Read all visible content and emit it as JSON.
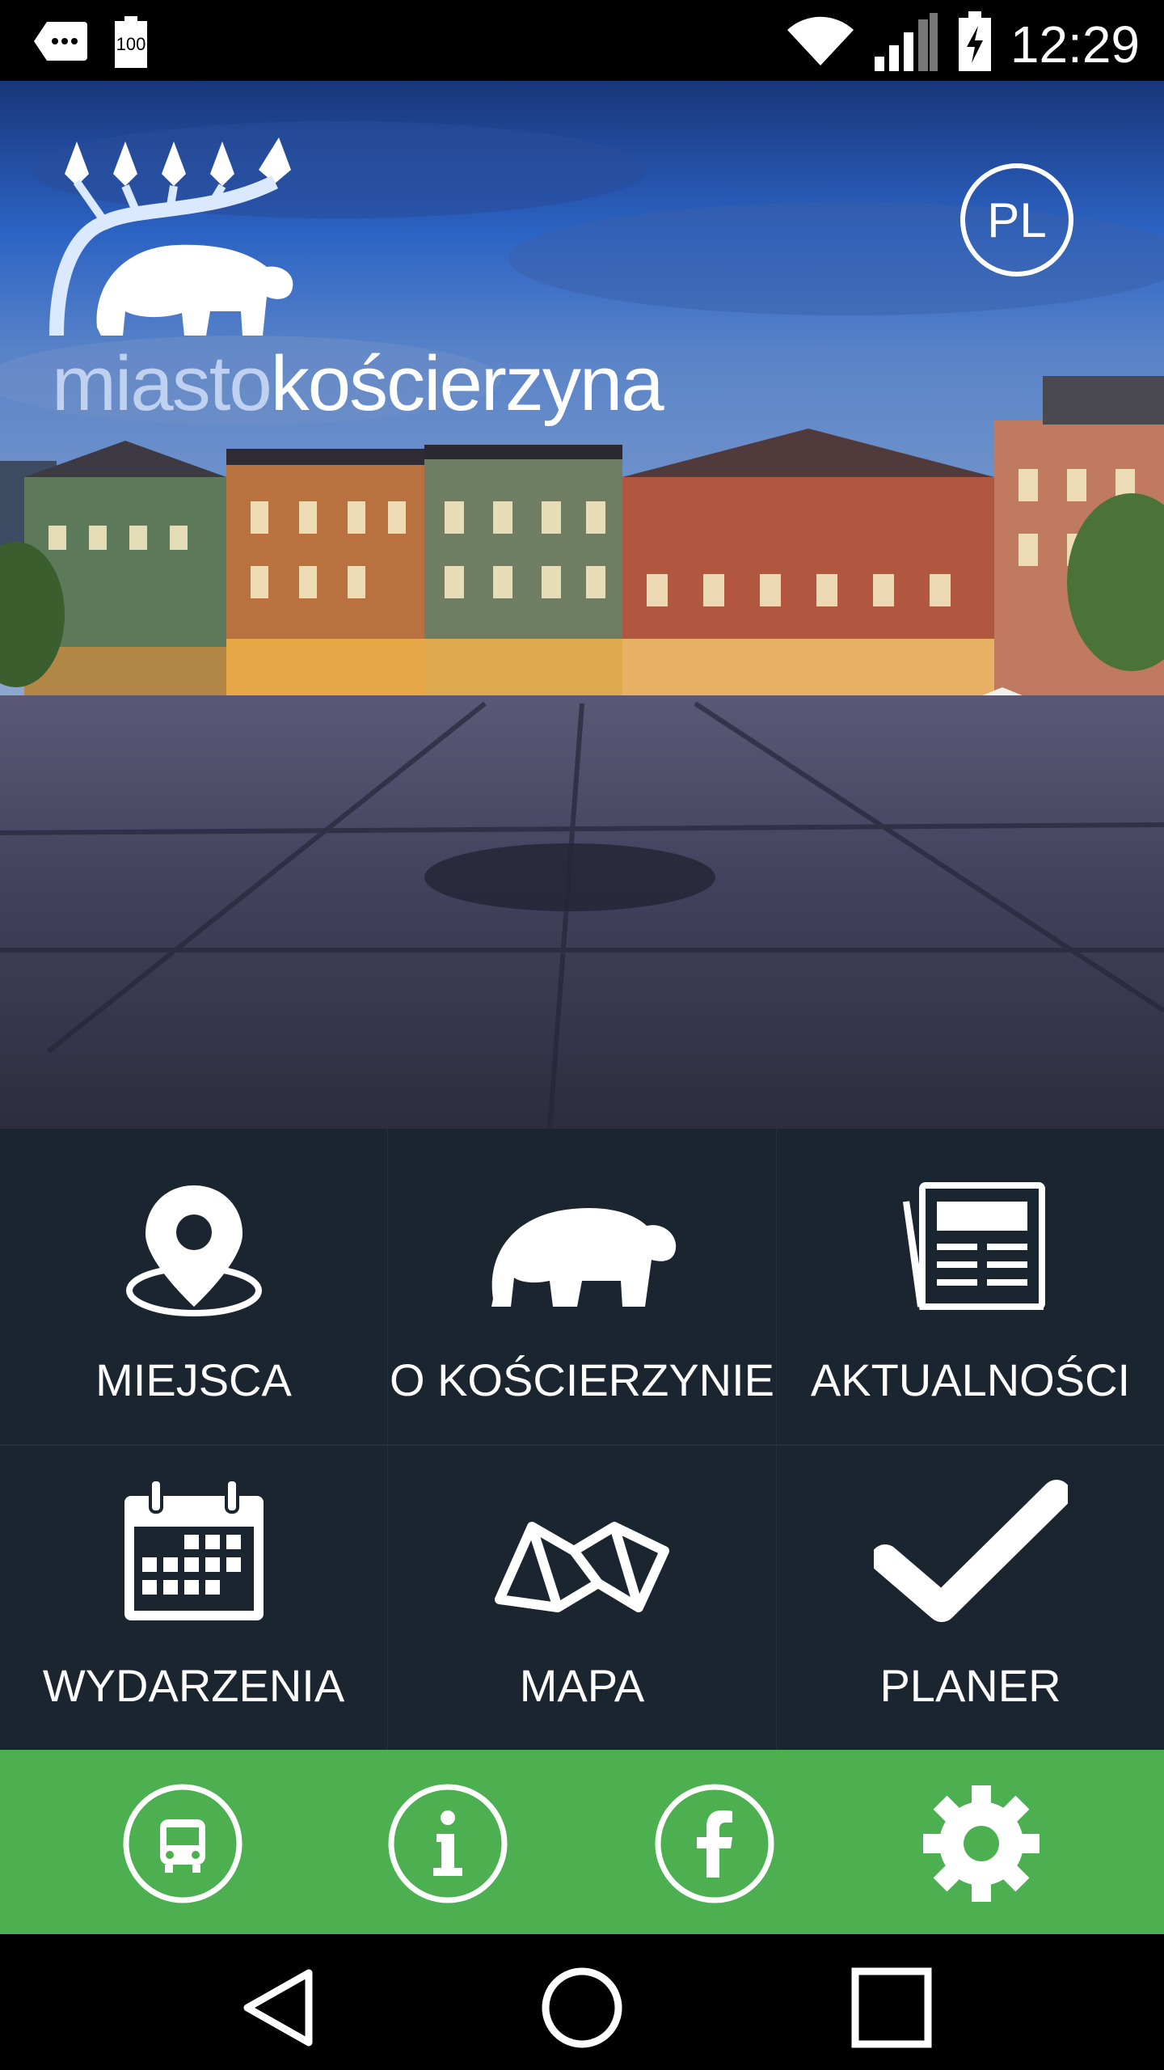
{
  "status_bar": {
    "time": "12:29",
    "battery_level": "100",
    "icons": [
      "overflow-icon",
      "battery-full-icon",
      "wifi-icon",
      "signal-icon",
      "battery-charging-icon"
    ]
  },
  "hero": {
    "logo_text_light": "miasto",
    "logo_text_bold": "kościerzyna",
    "language_button": "PL"
  },
  "menu": {
    "tiles": [
      {
        "label": "MIEJSCA",
        "icon": "map-pin-icon"
      },
      {
        "label": "O KOŚCIERZYNIE",
        "icon": "bear-icon"
      },
      {
        "label": "AKTUALNOŚCI",
        "icon": "newspaper-icon"
      },
      {
        "label": "WYDARZENIA",
        "icon": "calendar-icon"
      },
      {
        "label": "MAPA",
        "icon": "folded-map-icon"
      },
      {
        "label": "PLANER",
        "icon": "checkmark-icon"
      }
    ]
  },
  "actions": {
    "background_color": "#4caf50",
    "items": [
      "bus-icon",
      "info-icon",
      "facebook-icon",
      "settings-icon"
    ]
  },
  "navigation": {
    "items": [
      "back-icon",
      "home-icon",
      "recents-icon"
    ]
  }
}
